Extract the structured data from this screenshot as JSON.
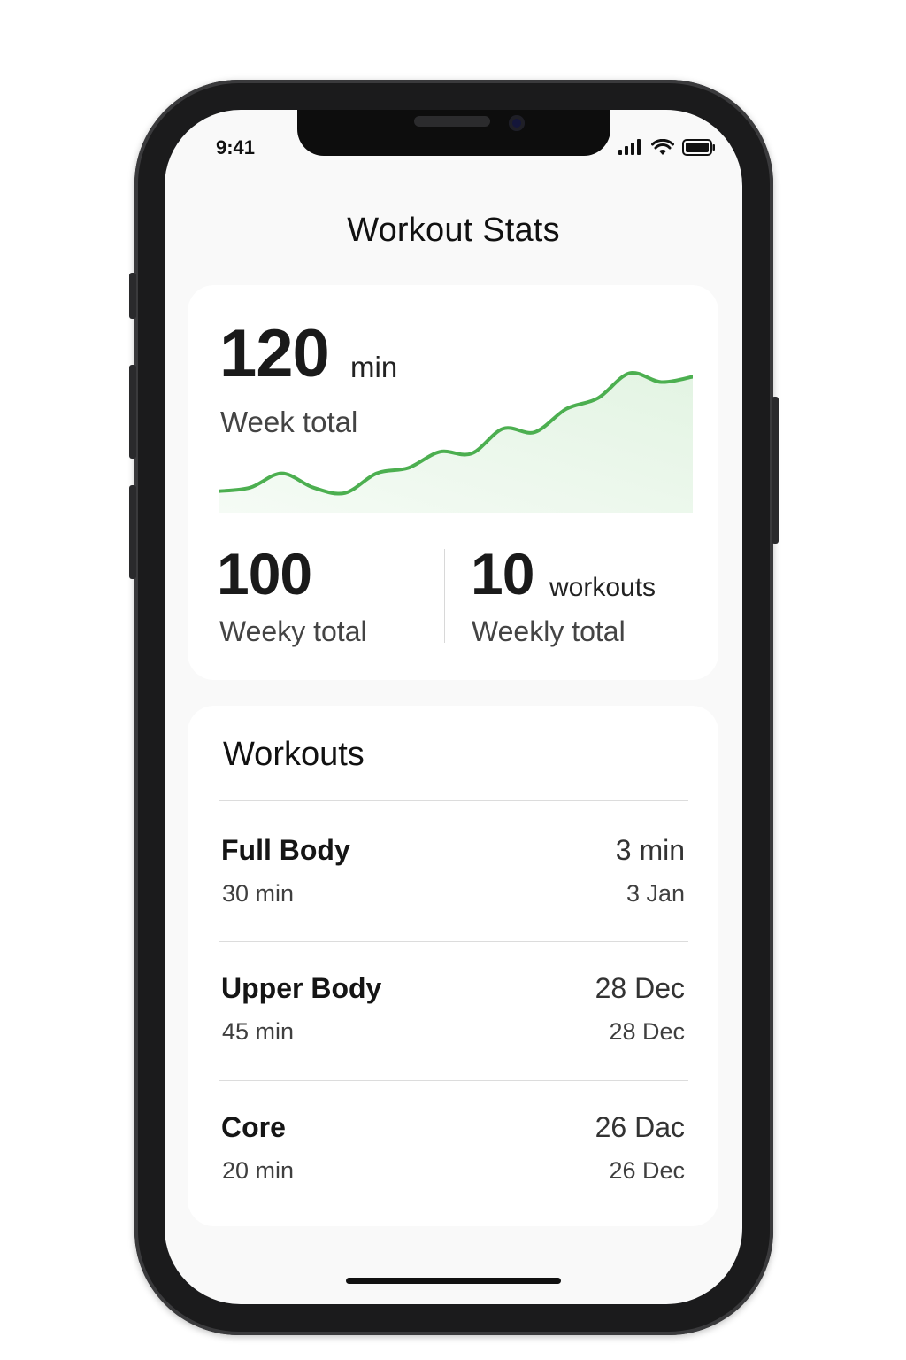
{
  "status_bar": {
    "time": "9:41",
    "icons": [
      "signal-icon",
      "wifi-icon",
      "battery-icon"
    ]
  },
  "header": {
    "title": "Workout Stats"
  },
  "summary": {
    "total_value": "120",
    "total_unit": "min",
    "total_label": "Week total",
    "left_stat": {
      "value": "100",
      "label": "Weeky total"
    },
    "right_stat": {
      "value": "10",
      "unit": "workouts",
      "label": "Weekly total"
    }
  },
  "chart_data": {
    "type": "area",
    "x": [
      0,
      1,
      2,
      3,
      4,
      5,
      6,
      7,
      8,
      9,
      10,
      11,
      12,
      13,
      14,
      15
    ],
    "values": [
      12,
      14,
      22,
      14,
      11,
      22,
      25,
      34,
      33,
      47,
      45,
      58,
      64,
      78,
      73,
      76
    ],
    "ylim": [
      0,
      100
    ],
    "line_color": "#4caf50",
    "fill_color": "#e3f4e3",
    "grid": false,
    "axes_visible": false
  },
  "workouts": {
    "title": "Workouts",
    "items": [
      {
        "name": "Full Body",
        "duration": "30 min",
        "right_top": "3 min",
        "right_bottom": "3 Jan"
      },
      {
        "name": "Upper Body",
        "duration": "45 min",
        "right_top": "28 Dec",
        "right_bottom": "28 Dec"
      },
      {
        "name": "Core",
        "duration": "20 min",
        "right_top": "26 Dac",
        "right_bottom": "26 Dec"
      }
    ]
  },
  "colors": {
    "accent": "#4caf50",
    "background": "#f9f9f9",
    "card": "#ffffff",
    "frame": "#1b1b1c"
  }
}
